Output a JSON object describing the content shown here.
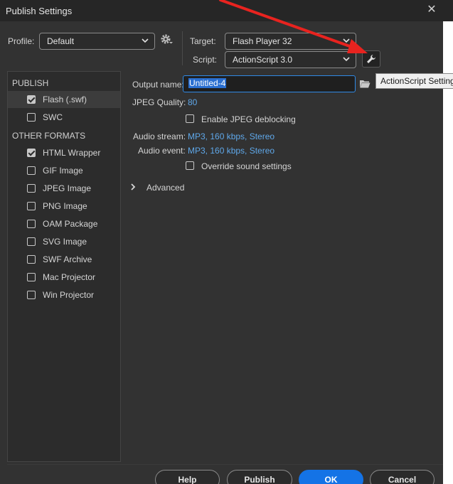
{
  "window": {
    "title": "Publish Settings",
    "close": "✕"
  },
  "profile": {
    "label": "Profile:",
    "value": "Default"
  },
  "target": {
    "label": "Target:",
    "value": "Flash Player 32"
  },
  "script": {
    "label": "Script:",
    "value": "ActionScript 3.0"
  },
  "tooltip": "ActionScript Settings",
  "sidebar": {
    "publish_header": "PUBLISH",
    "other_header": "OTHER FORMATS",
    "items": [
      {
        "label": "Flash (.swf)",
        "checked": true,
        "selected": true
      },
      {
        "label": "SWC",
        "checked": false
      },
      {
        "label": "HTML Wrapper",
        "checked": true
      },
      {
        "label": "GIF Image",
        "checked": false
      },
      {
        "label": "JPEG Image",
        "checked": false
      },
      {
        "label": "PNG Image",
        "checked": false
      },
      {
        "label": "OAM Package",
        "checked": false
      },
      {
        "label": "SVG Image",
        "checked": false
      },
      {
        "label": "SWF Archive",
        "checked": false
      },
      {
        "label": "Mac Projector",
        "checked": false
      },
      {
        "label": "Win Projector",
        "checked": false
      }
    ]
  },
  "settings": {
    "output_label": "Output name:",
    "output_value": "Untitled-4",
    "jpeg_label": "JPEG Quality:",
    "jpeg_value": "80",
    "deblock_label": "Enable JPEG deblocking",
    "deblock_checked": false,
    "audio_stream_label": "Audio stream:",
    "audio_stream_value": "MP3, 160 kbps, Stereo",
    "audio_event_label": "Audio event:",
    "audio_event_value": "MP3, 160 kbps, Stereo",
    "override_label": "Override sound settings",
    "override_checked": false,
    "advanced_label": "Advanced"
  },
  "buttons": {
    "help": "Help",
    "publish": "Publish",
    "ok": "OK",
    "cancel": "Cancel"
  },
  "colors": {
    "accent": "#1473e6",
    "link": "#5fa8ea",
    "annotation_arrow": "#e8231f"
  }
}
